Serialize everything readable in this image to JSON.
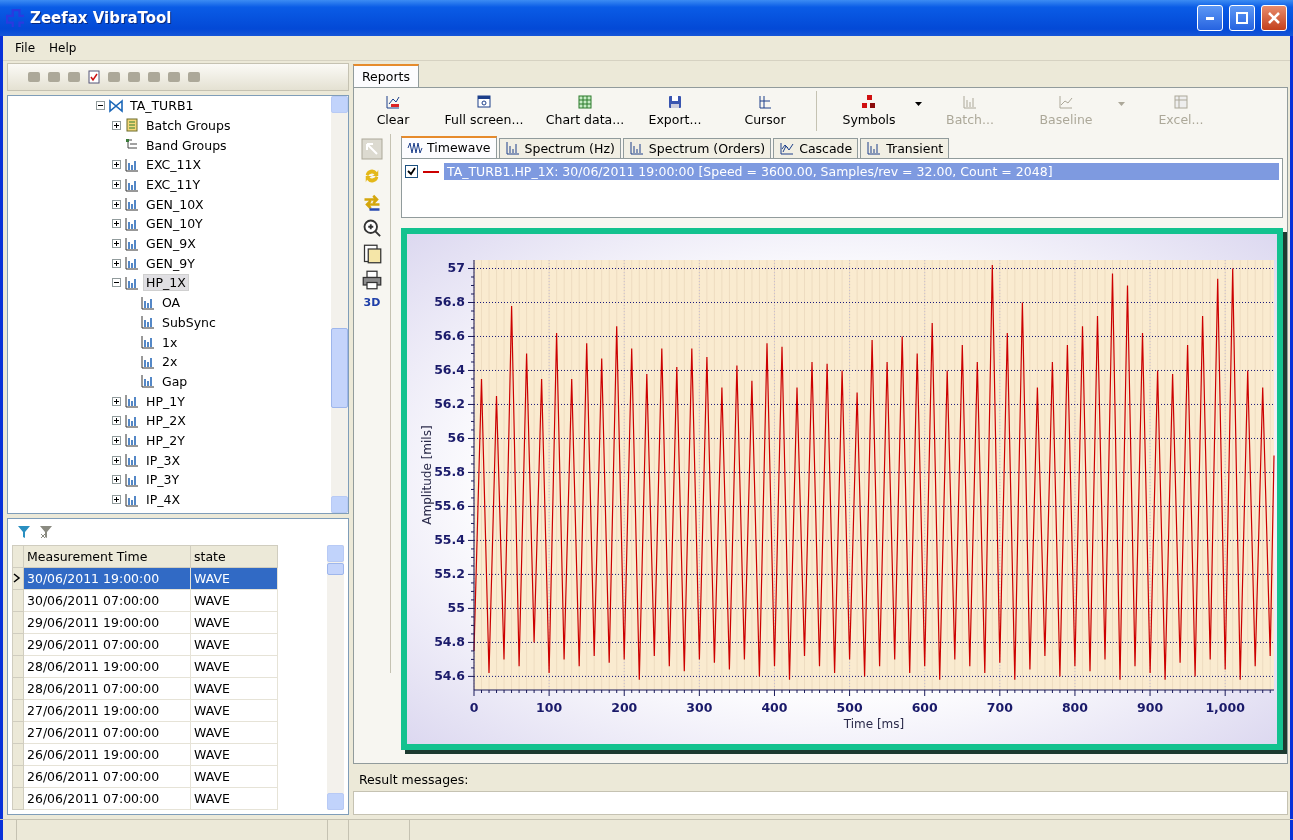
{
  "window": {
    "title": "Zeefax VibraTool"
  },
  "menu": [
    "File",
    "Help"
  ],
  "tree": [
    {
      "label": "TA_TURB1",
      "kind": "machine",
      "expanded": true,
      "selected": false,
      "children": [
        {
          "label": "Batch Groups",
          "kind": "batch",
          "expanded": false,
          "selected": false
        },
        {
          "label": "Band Groups",
          "kind": "band",
          "selected": false
        },
        {
          "label": "EXC_11X",
          "kind": "channel",
          "expanded": false,
          "selected": false
        },
        {
          "label": "EXC_11Y",
          "kind": "channel",
          "expanded": false,
          "selected": false
        },
        {
          "label": "GEN_10X",
          "kind": "channel",
          "expanded": false,
          "selected": false
        },
        {
          "label": "GEN_10Y",
          "kind": "channel",
          "expanded": false,
          "selected": false
        },
        {
          "label": "GEN_9X",
          "kind": "channel",
          "expanded": false,
          "selected": false
        },
        {
          "label": "GEN_9Y",
          "kind": "channel",
          "expanded": false,
          "selected": false
        },
        {
          "label": "HP_1X",
          "kind": "channel",
          "expanded": true,
          "selected": true,
          "children": [
            {
              "label": "OA",
              "kind": "channel",
              "selected": false
            },
            {
              "label": "SubSync",
              "kind": "channel",
              "selected": false
            },
            {
              "label": "1x",
              "kind": "channel",
              "selected": false
            },
            {
              "label": "2x",
              "kind": "channel",
              "selected": false
            },
            {
              "label": "Gap",
              "kind": "channel",
              "selected": false
            }
          ]
        },
        {
          "label": "HP_1Y",
          "kind": "channel",
          "expanded": false,
          "selected": false
        },
        {
          "label": "HP_2X",
          "kind": "channel",
          "expanded": false,
          "selected": false
        },
        {
          "label": "HP_2Y",
          "kind": "channel",
          "expanded": false,
          "selected": false
        },
        {
          "label": "IP_3X",
          "kind": "channel",
          "expanded": false,
          "selected": false
        },
        {
          "label": "IP_3Y",
          "kind": "channel",
          "expanded": false,
          "selected": false
        },
        {
          "label": "IP_4X",
          "kind": "channel",
          "expanded": false,
          "selected": false
        }
      ]
    }
  ],
  "measurements": {
    "columns": [
      "Measurement Time",
      "state"
    ],
    "rows": [
      {
        "time": "30/06/2011 19:00:00",
        "state": "WAVE",
        "selected": true
      },
      {
        "time": "30/06/2011 07:00:00",
        "state": "WAVE",
        "selected": false
      },
      {
        "time": "29/06/2011 19:00:00",
        "state": "WAVE",
        "selected": false
      },
      {
        "time": "29/06/2011 07:00:00",
        "state": "WAVE",
        "selected": false
      },
      {
        "time": "28/06/2011 19:00:00",
        "state": "WAVE",
        "selected": false
      },
      {
        "time": "28/06/2011 07:00:00",
        "state": "WAVE",
        "selected": false
      },
      {
        "time": "27/06/2011 19:00:00",
        "state": "WAVE",
        "selected": false
      },
      {
        "time": "27/06/2011 07:00:00",
        "state": "WAVE",
        "selected": false
      },
      {
        "time": "26/06/2011 19:00:00",
        "state": "WAVE",
        "selected": false
      },
      {
        "time": "26/06/2011 07:00:00",
        "state": "WAVE",
        "selected": false
      },
      {
        "time": "26/06/2011 07:00:00",
        "state": "WAVE",
        "selected": false
      }
    ]
  },
  "reports_tab": "Reports",
  "toolbar": [
    {
      "label": "Clear",
      "kind": "clear",
      "disabled": false
    },
    {
      "label": "Full screen...",
      "kind": "fullscreen",
      "disabled": false
    },
    {
      "label": "Chart data...",
      "kind": "grid",
      "disabled": false
    },
    {
      "label": "Export...",
      "kind": "disk",
      "disabled": false
    },
    {
      "label": "Cursor",
      "kind": "cursor",
      "disabled": false
    },
    {
      "label": "Symbols",
      "kind": "symbols",
      "disabled": false,
      "dropdown": true
    },
    {
      "label": "Batch...",
      "kind": "bars",
      "disabled": true
    },
    {
      "label": "Baseline",
      "kind": "line",
      "disabled": true,
      "dropdown": true
    },
    {
      "label": "Excel...",
      "kind": "sheet",
      "disabled": true
    }
  ],
  "view_3d_button": "3D",
  "chart_tabs": [
    {
      "label": "Timewave",
      "kind": "wave",
      "selected": true
    },
    {
      "label": "Spectrum (Hz)",
      "kind": "bars",
      "selected": false
    },
    {
      "label": "Spectrum (Orders)",
      "kind": "bars",
      "selected": false
    },
    {
      "label": "Cascade",
      "kind": "cascade",
      "selected": false
    },
    {
      "label": "Transient",
      "kind": "bars",
      "selected": false
    }
  ],
  "legend": [
    {
      "label": "TA_TURB1.HP_1X: 30/06/2011 19:00:00 [Speed = 3600.00, Samples/rev = 32.00, Count = 2048]",
      "checked": true,
      "selected": true,
      "color": "#cc0000"
    }
  ],
  "chart": {
    "chart_data": {
      "type": "line",
      "grid": true,
      "xlabel": "Time [ms]",
      "ylabel": "Amplitude [mils]",
      "xlim": [
        0,
        1065
      ],
      "ylim": [
        54.52,
        57.05
      ],
      "xticks": [
        0,
        100,
        200,
        300,
        400,
        500,
        600,
        700,
        800,
        900,
        {
          "value": 1000,
          "label": "1,000"
        }
      ],
      "yticks": [
        54.6,
        54.8,
        55,
        55.2,
        55.4,
        55.6,
        55.8,
        56,
        56.2,
        56.4,
        56.6,
        56.8,
        57
      ],
      "x": [
        0,
        10,
        20,
        30,
        40,
        50,
        60,
        70,
        80,
        90,
        100,
        110,
        120,
        130,
        140,
        150,
        160,
        170,
        180,
        190,
        200,
        210,
        220,
        230,
        240,
        250,
        260,
        270,
        280,
        290,
        300,
        310,
        320,
        330,
        340,
        350,
        360,
        370,
        380,
        390,
        400,
        410,
        420,
        430,
        440,
        450,
        460,
        470,
        480,
        490,
        500,
        510,
        520,
        530,
        540,
        550,
        560,
        570,
        580,
        590,
        600,
        610,
        620,
        630,
        640,
        650,
        660,
        670,
        680,
        690,
        700,
        710,
        720,
        730,
        740,
        750,
        760,
        770,
        780,
        790,
        800,
        810,
        820,
        830,
        840,
        850,
        860,
        870,
        880,
        890,
        900,
        910,
        920,
        930,
        940,
        950,
        960,
        970,
        980,
        990,
        1000,
        1010,
        1020,
        1030,
        1040,
        1050,
        1060,
        1065
      ],
      "series": [
        {
          "color": "#cc0000",
          "values": [
            54.75,
            56.35,
            54.62,
            56.25,
            54.7,
            56.78,
            54.66,
            56.5,
            54.8,
            56.35,
            54.62,
            56.62,
            54.7,
            56.35,
            54.66,
            56.56,
            54.72,
            56.47,
            54.68,
            56.66,
            54.7,
            56.53,
            54.58,
            56.38,
            54.72,
            56.53,
            54.66,
            56.42,
            54.63,
            56.53,
            54.7,
            56.48,
            54.68,
            56.3,
            54.64,
            56.43,
            54.7,
            56.34,
            54.6,
            56.56,
            54.66,
            56.54,
            54.58,
            56.3,
            54.72,
            56.45,
            54.66,
            56.44,
            54.62,
            56.4,
            54.7,
            56.27,
            54.6,
            56.58,
            54.66,
            56.45,
            54.7,
            56.6,
            54.62,
            56.5,
            54.66,
            56.68,
            54.58,
            56.4,
            54.7,
            56.55,
            54.66,
            56.45,
            54.62,
            57.02,
            54.68,
            56.62,
            54.58,
            56.8,
            54.64,
            56.3,
            54.72,
            56.45,
            54.6,
            56.55,
            54.66,
            56.66,
            54.63,
            56.72,
            54.7,
            56.97,
            54.58,
            56.9,
            54.66,
            56.62,
            54.62,
            56.4,
            54.58,
            56.38,
            54.68,
            56.55,
            54.6,
            56.72,
            54.7,
            56.94,
            54.64,
            57,
            54.58,
            56.4,
            54.66,
            56.3,
            54.72,
            55.9
          ]
        }
      ]
    }
  },
  "result_label": "Result messages:"
}
